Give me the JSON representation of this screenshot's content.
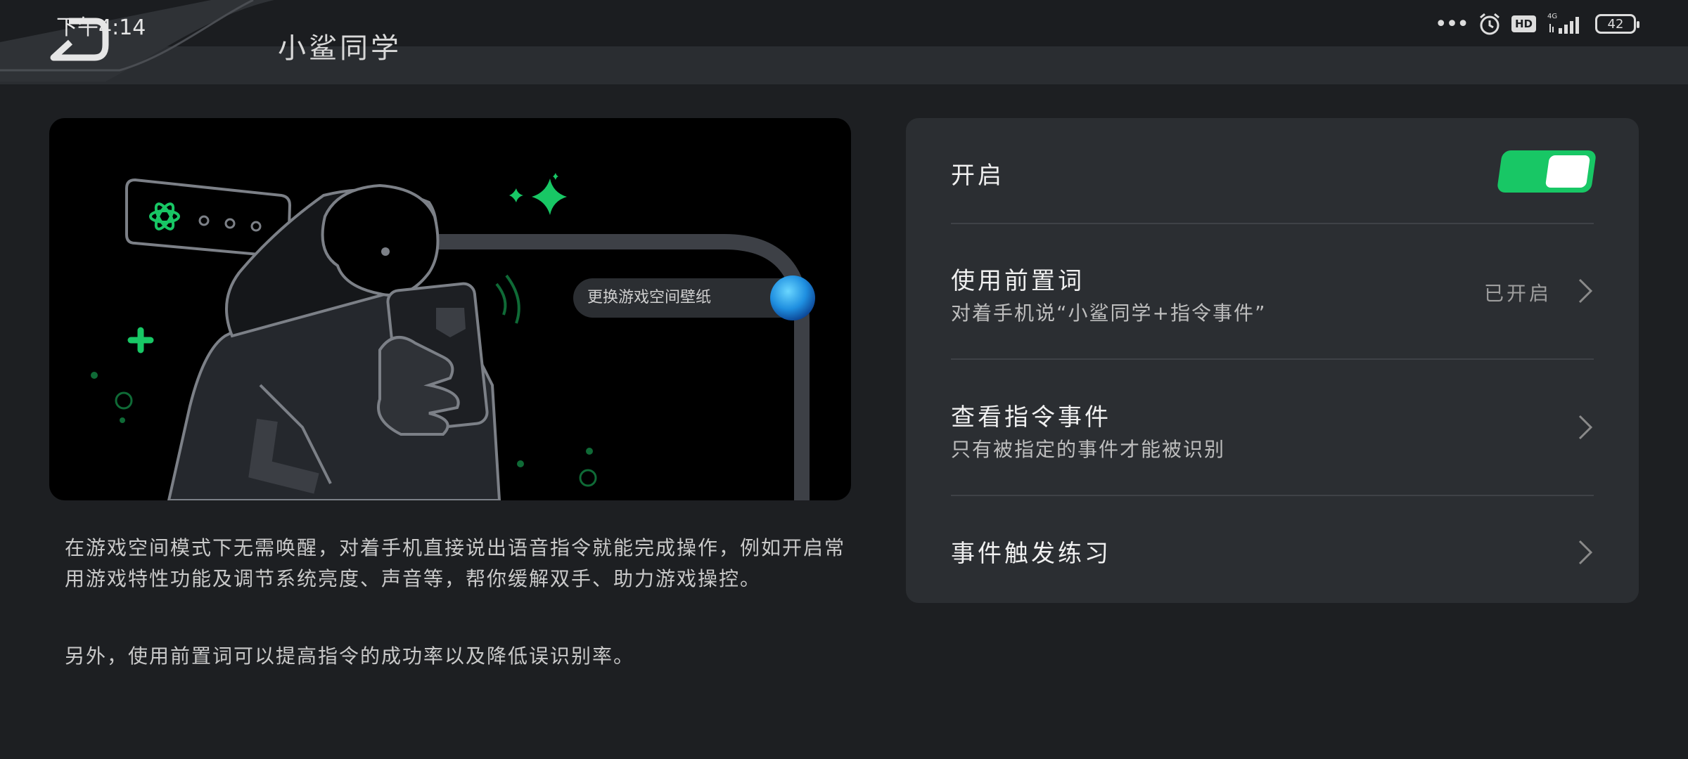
{
  "status_bar": {
    "time": "下午4:14",
    "signal_label": "4G",
    "hd_label": "HD",
    "battery": "42"
  },
  "header": {
    "title": "小鲨同学"
  },
  "hero": {
    "wallpaper_button_label": "更换游戏空间壁纸"
  },
  "description": {
    "paragraph1": "在游戏空间模式下无需唤醒，对着手机直接说出语音指令就能完成操作，例如开启常用游戏特性功能及调节系统亮度、声音等，帮你缓解双手、助力游戏操控。",
    "paragraph2": "另外，使用前置词可以提高指令的成功率以及降低误识别率。"
  },
  "settings": {
    "enable": {
      "label": "开启",
      "on": true
    },
    "prefix": {
      "label": "使用前置词",
      "subtitle": "对着手机说“小鲨同学+指令事件”",
      "value": "已开启"
    },
    "commands": {
      "label": "查看指令事件",
      "subtitle": "只有被指定的事件才能被识别"
    },
    "practice": {
      "label": "事件触发练习"
    }
  },
  "colors": {
    "accent": "#18c765",
    "background": "#1d1f22",
    "card": "#2b2e32"
  }
}
